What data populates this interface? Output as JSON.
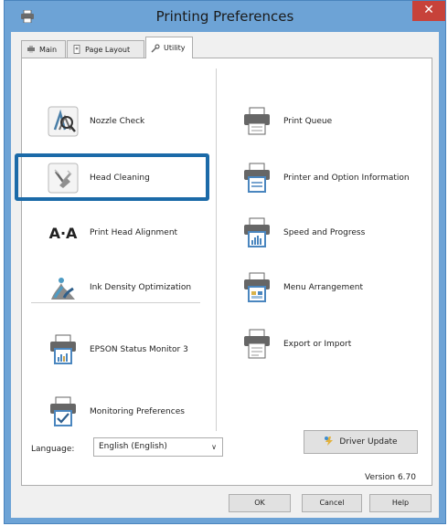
{
  "window": {
    "title": "Printing Preferences",
    "close_glyph": "✕"
  },
  "tabs": [
    {
      "label": "Main",
      "icon": "printer-icon",
      "active": false
    },
    {
      "label": "Page Layout",
      "icon": "page-icon",
      "active": false
    },
    {
      "label": "Utility",
      "icon": "wrench-icon",
      "active": true
    }
  ],
  "left_items": [
    {
      "label": "Nozzle Check",
      "icon": "nozzle-check-icon"
    },
    {
      "label": "Head Cleaning",
      "icon": "head-cleaning-icon"
    },
    {
      "label": "Print Head Alignment",
      "icon": "alignment-icon",
      "icon_text": "A·A"
    },
    {
      "label": "Ink Density Optimization",
      "icon": "ink-density-icon"
    },
    {
      "label": "EPSON Status Monitor 3",
      "icon": "status-monitor-icon"
    },
    {
      "label": "Monitoring Preferences",
      "icon": "monitoring-preferences-icon"
    }
  ],
  "right_items": [
    {
      "label": "Print Queue",
      "icon": "print-queue-icon"
    },
    {
      "label": "Printer and Option Information",
      "icon": "printer-info-icon"
    },
    {
      "label": "Speed and Progress",
      "icon": "speed-progress-icon"
    },
    {
      "label": "Menu Arrangement",
      "icon": "menu-arrangement-icon"
    },
    {
      "label": "Export or Import",
      "icon": "export-import-icon"
    }
  ],
  "language": {
    "label": "Language:",
    "value": "English (English)"
  },
  "driver_update": {
    "label": "Driver Update"
  },
  "version": "Version 6.70",
  "buttons": {
    "ok": "OK",
    "cancel": "Cancel",
    "help": "Help"
  },
  "colors": {
    "titlebar": "#6da3d6",
    "highlight": "#1b6aa8",
    "close": "#c7423a"
  }
}
